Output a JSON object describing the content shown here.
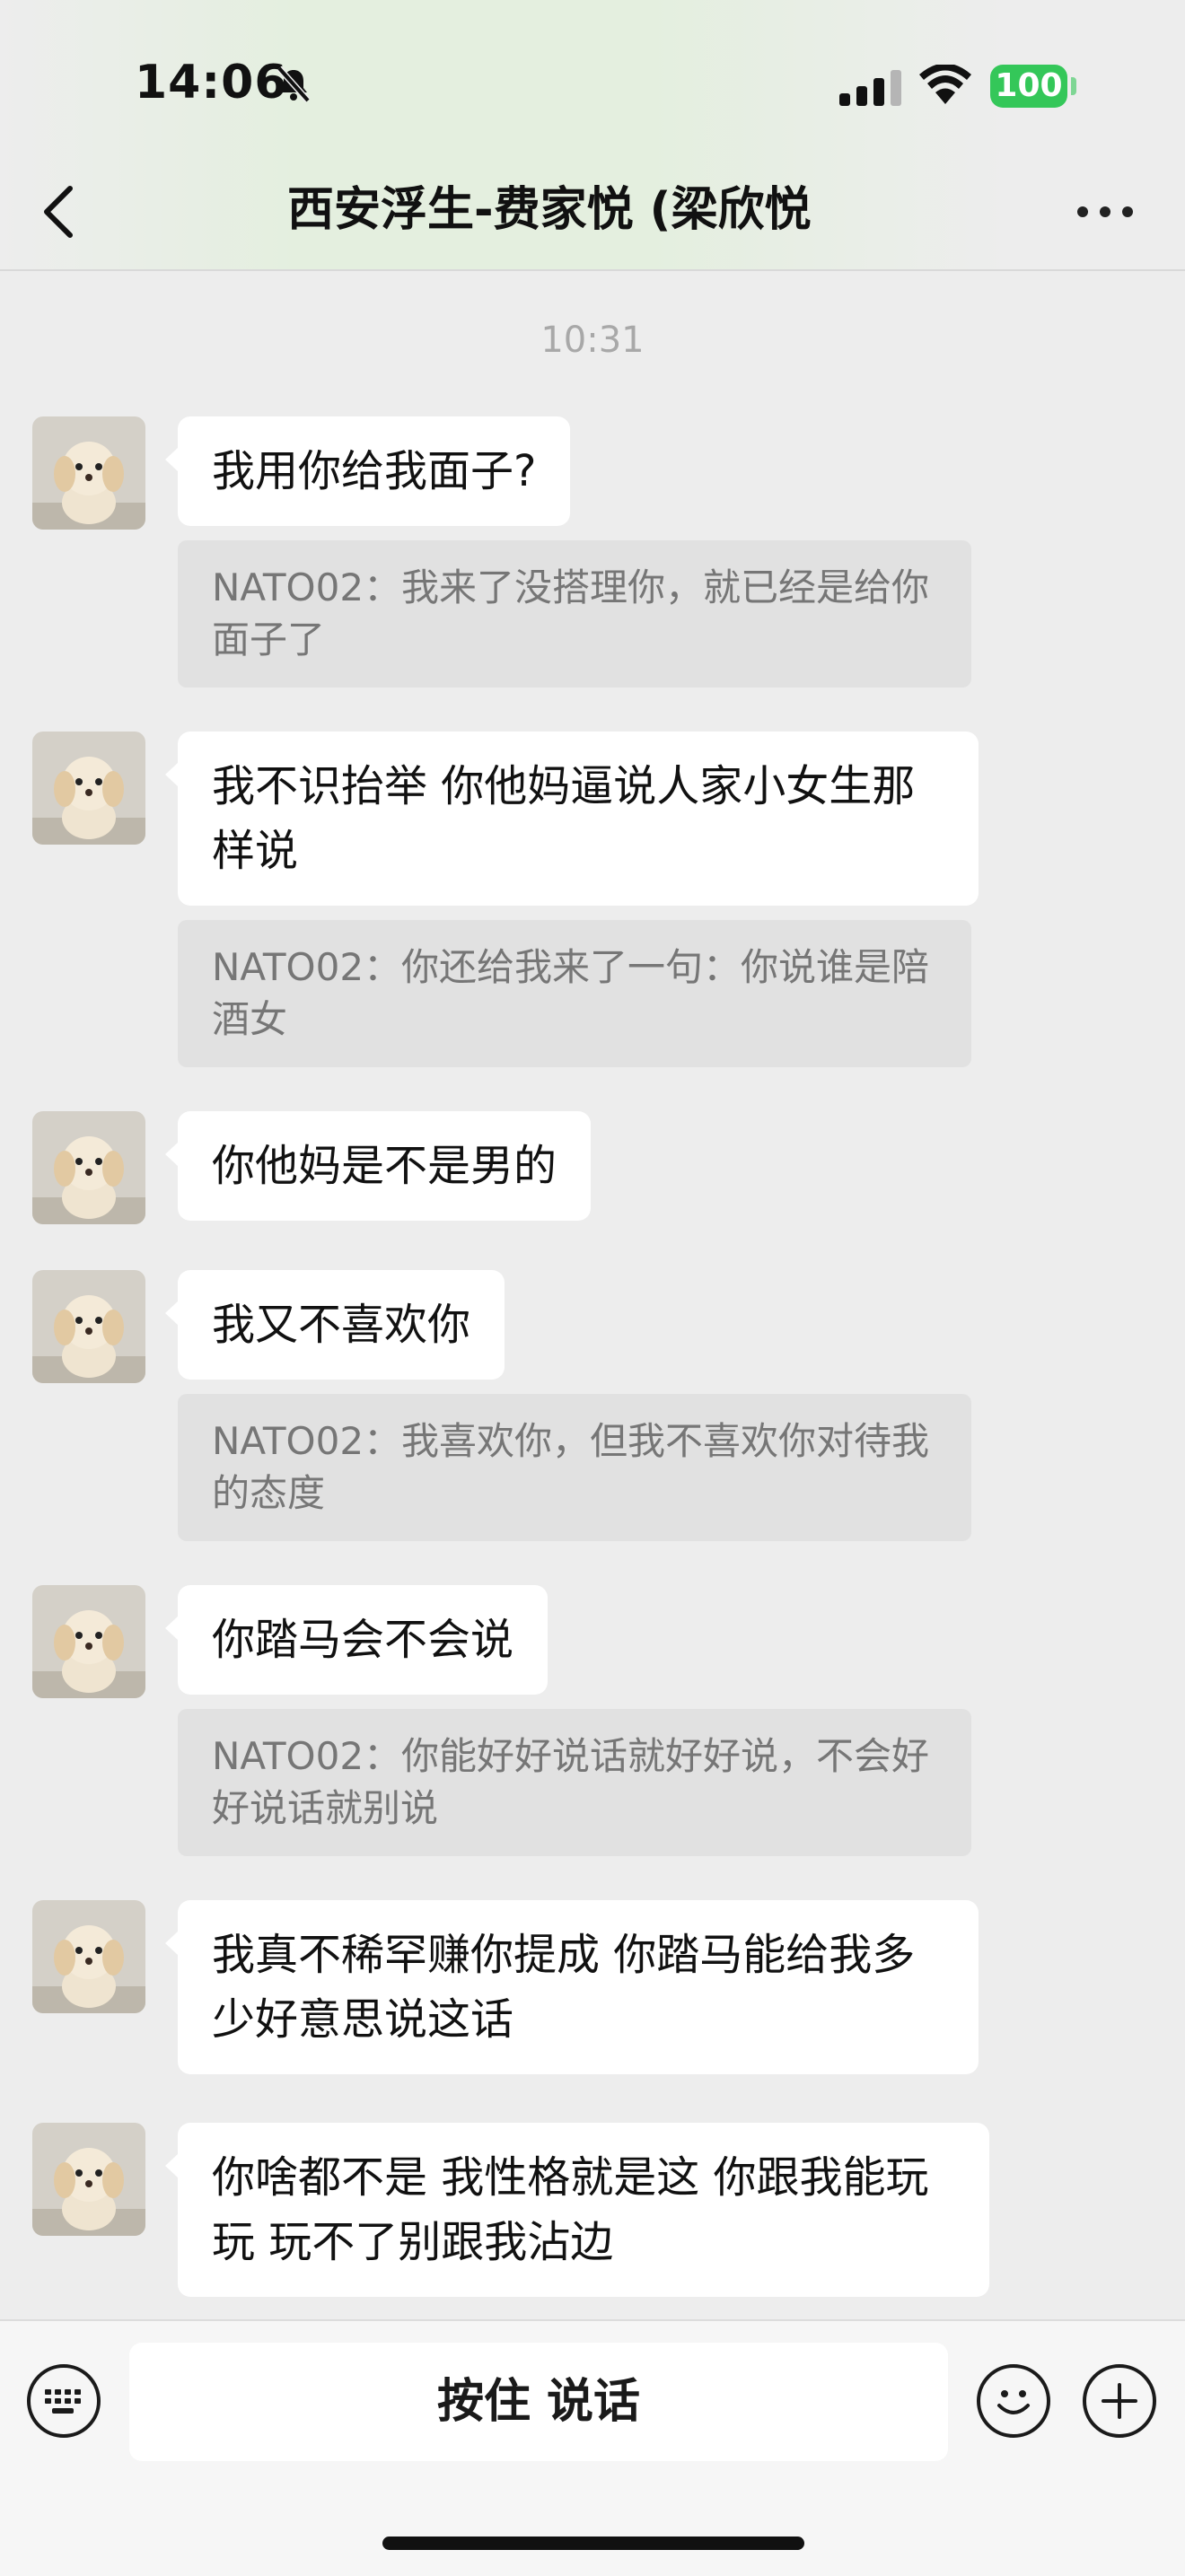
{
  "status_bar": {
    "time": "14:06",
    "battery": "100"
  },
  "header": {
    "title": "西安浮生-费家悦 (梁欣悦"
  },
  "chat": {
    "timestamp": "10:31",
    "messages": [
      {
        "text": "我用你给我面子?",
        "quote": "NATO02：我来了没搭理你，就已经是给你面子了"
      },
      {
        "text": "我不识抬举 你他妈逼说人家小女生那样说",
        "quote": "NATO02：你还给我来了一句：你说谁是陪酒女"
      },
      {
        "text": "你他妈是不是男的",
        "quote": ""
      },
      {
        "text": "我又不喜欢你",
        "quote": "NATO02：我喜欢你，但我不喜欢你对待我的态度"
      },
      {
        "text": "你踏马会不会说",
        "quote": "NATO02：你能好好说话就好好说，不会好好说话就别说"
      },
      {
        "text": "我真不稀罕赚你提成 你踏马能给我多少好意思说这话",
        "quote": ""
      },
      {
        "text": "你啥都不是 我性格就是这 你跟我能玩玩 玩不了别跟我沾边",
        "quote": ""
      }
    ]
  },
  "input_bar": {
    "voice_label": "按住 说话"
  }
}
